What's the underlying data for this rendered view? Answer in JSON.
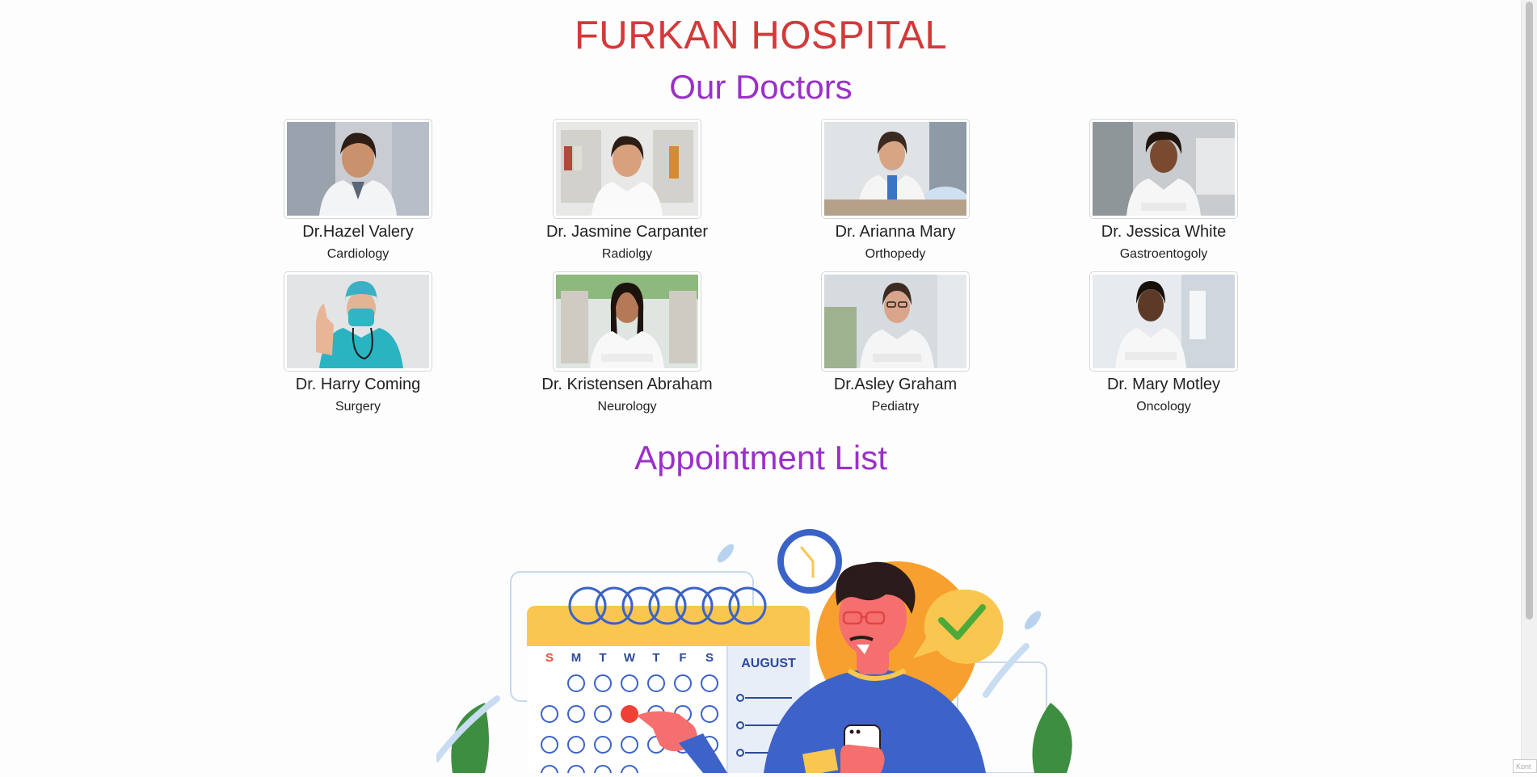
{
  "hospital": {
    "title": "FURKAN HOSPITAL"
  },
  "sections": {
    "doctors_title": "Our Doctors",
    "appointments_title": "Appointment List"
  },
  "doctors": [
    {
      "name": "Dr.Hazel Valery",
      "department": "Cardiology"
    },
    {
      "name": "Dr. Jasmine Carpanter",
      "department": "Radiolgy"
    },
    {
      "name": "Dr. Arianna Mary",
      "department": "Orthopedy"
    },
    {
      "name": "Dr. Jessica White",
      "department": "Gastroentogoly"
    },
    {
      "name": "Dr. Harry Coming",
      "department": "Surgery"
    },
    {
      "name": "Dr. Kristensen Abraham",
      "department": "Neurology"
    },
    {
      "name": "Dr.Asley Graham",
      "department": "Pediatry"
    },
    {
      "name": "Dr. Mary Motley",
      "department": "Oncology"
    }
  ],
  "calendar": {
    "month": "AUGUST",
    "weekdays": [
      "S",
      "M",
      "T",
      "W",
      "T",
      "F",
      "S"
    ]
  },
  "colors": {
    "title": "#d23a3a",
    "section": "#9b30c8",
    "calendar_header": "#f9c74f",
    "calendar_blue": "#3a63c8",
    "highlight_day": "#ee4035",
    "sun_orange": "#f7a02f",
    "check_bubble": "#f9c74f",
    "check_mark": "#4caa3a"
  },
  "corner": {
    "text": "Kont"
  }
}
